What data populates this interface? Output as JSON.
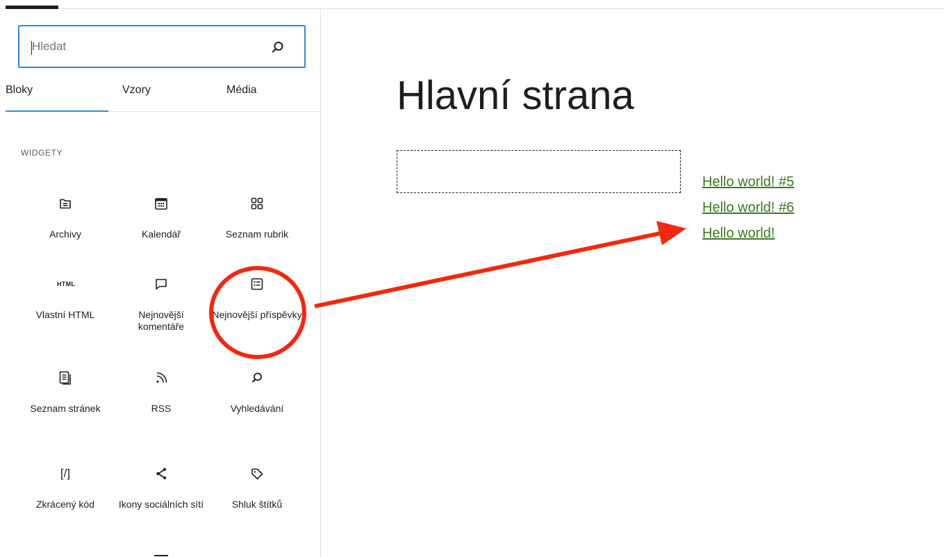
{
  "search": {
    "placeholder": "Hledat",
    "icon": "search-icon"
  },
  "tabs": [
    {
      "label": "Bloky",
      "active": true
    },
    {
      "label": "Vzory",
      "active": false
    },
    {
      "label": "Média",
      "active": false
    }
  ],
  "section": {
    "title": "WIDGETY"
  },
  "blocks": [
    {
      "label": "Archivy",
      "icon": "archive-icon"
    },
    {
      "label": "Kalendář",
      "icon": "calendar-icon"
    },
    {
      "label": "Seznam rubrik",
      "icon": "categories-icon"
    },
    {
      "label": "Vlastní HTML",
      "icon": "html-icon",
      "icon_text": "HTML"
    },
    {
      "label": "Nejnovější komentáře",
      "icon": "comment-icon"
    },
    {
      "label": "Nejnovější příspěvky",
      "icon": "post-list-icon"
    },
    {
      "label": "Seznam stránek",
      "icon": "pages-icon"
    },
    {
      "label": "RSS",
      "icon": "rss-icon"
    },
    {
      "label": "Vyhledávání",
      "icon": "search-icon"
    },
    {
      "label": "Zkrácený kód",
      "icon": "shortcode-icon",
      "icon_text": "[/]"
    },
    {
      "label": "Ikony sociálních sítí",
      "icon": "share-icon"
    },
    {
      "label": "Shluk štítků",
      "icon": "tag-icon"
    }
  ],
  "page": {
    "title": "Hlavní strana"
  },
  "posts": [
    "Hello world! #5",
    "Hello world! #6",
    "Hello world!"
  ],
  "colors": {
    "accent": "#2f8ad8",
    "link": "#3a7a1c",
    "annotation": "#f2280f"
  }
}
